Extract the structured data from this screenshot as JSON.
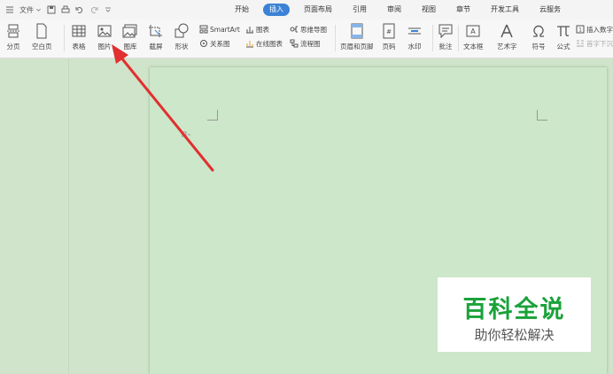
{
  "menubar": {
    "file_label": "文件",
    "tabs": [
      "开始",
      "插入",
      "页面布局",
      "引用",
      "审阅",
      "视图",
      "章节",
      "开发工具",
      "云服务"
    ],
    "active_tab": "插入"
  },
  "ribbon": {
    "page_break": "分页",
    "blank_page": "空白页",
    "table": "表格",
    "picture": "图片",
    "gallery": "图库",
    "screenshot": "截屏",
    "shape": "形状",
    "smartart": "SmartArt",
    "relation_chart": "关系图",
    "chart": "图表",
    "online_chart": "在线图表",
    "mindmap": "思维导图",
    "flowchart": "流程图",
    "header_footer": "页眉和页脚",
    "page_number": "页码",
    "watermark": "水印",
    "comment": "批注",
    "textbox": "文本框",
    "wordart": "艺术字",
    "symbol": "符号",
    "formula": "公式",
    "insert_number": "插入数字",
    "first_letter_sink": "首字下沉"
  },
  "watermark": {
    "title": "百科全说",
    "subtitle": "助你轻松解决"
  },
  "colors": {
    "accent": "#3b82d6",
    "page_bg": "#cce7c9",
    "arrow": "#e03030",
    "watermark_green": "#1aa23a"
  }
}
